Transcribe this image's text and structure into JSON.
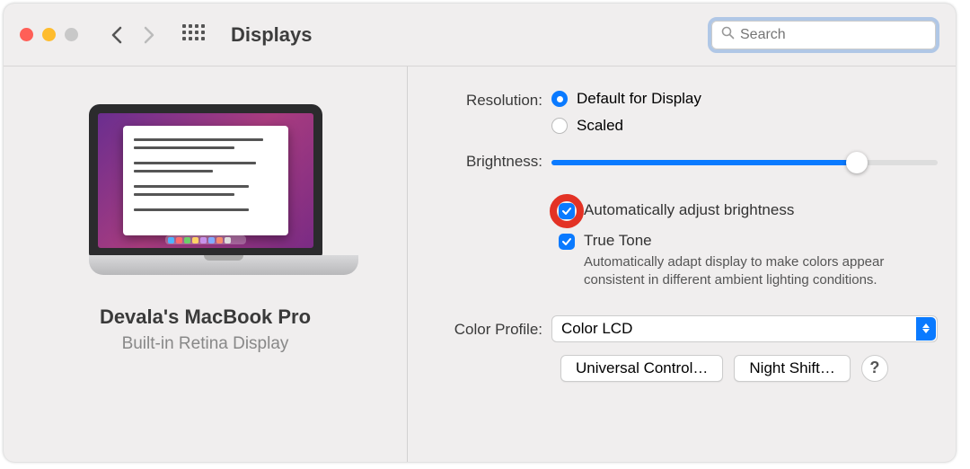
{
  "window": {
    "title": "Displays",
    "search_placeholder": "Search"
  },
  "device": {
    "name": "Devala's MacBook Pro",
    "type": "Built-in Retina Display"
  },
  "labels": {
    "resolution": "Resolution:",
    "brightness": "Brightness:",
    "color_profile": "Color Profile:"
  },
  "resolution": {
    "default_label": "Default for Display",
    "scaled_label": "Scaled",
    "selected": "default"
  },
  "brightness": {
    "percent": 79,
    "auto_label": "Automatically adjust brightness",
    "auto_checked": true,
    "truetone_label": "True Tone",
    "truetone_checked": true,
    "truetone_desc": "Automatically adapt display to make colors appear consistent in different ambient lighting conditions."
  },
  "color_profile": {
    "selected": "Color LCD"
  },
  "buttons": {
    "universal_control": "Universal Control…",
    "night_shift": "Night Shift…",
    "help": "?"
  },
  "colors": {
    "accent": "#0a7aff",
    "highlight_ring": "#e33225"
  }
}
